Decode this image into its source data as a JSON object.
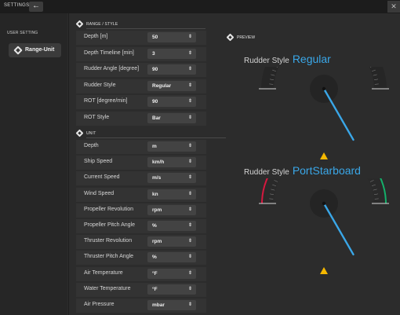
{
  "window": {
    "title": "SETTINGS",
    "back_icon": "arrow-left",
    "close_icon": "close"
  },
  "sidebar": {
    "label": "USER SETTING",
    "items": [
      {
        "label": "Range-Unit",
        "icon": "diamond"
      }
    ]
  },
  "range_style": {
    "title": "RANGE / STYLE",
    "rows": [
      {
        "label": "Depth [m]",
        "value": "50"
      },
      {
        "label": "Depth Timeline [min]",
        "value": "3"
      },
      {
        "label": "Rudder Angle [degree]",
        "value": "90"
      },
      {
        "label": "Rudder Style",
        "value": "Regular"
      },
      {
        "label": "ROT [degree/min]",
        "value": "90"
      },
      {
        "label": "ROT Style",
        "value": "Bar"
      }
    ]
  },
  "unit": {
    "title": "UNIT",
    "rows": [
      {
        "label": "Depth",
        "value": "m"
      },
      {
        "label": "Ship Speed",
        "value": "km/h"
      },
      {
        "label": "Current Speed",
        "value": "m/s"
      },
      {
        "label": "Wind Speed",
        "value": "kn"
      },
      {
        "label": "Propeller Revolution",
        "value": "rpm"
      },
      {
        "label": "Propeller Pitch Angle",
        "value": "%"
      },
      {
        "label": "Thruster Revolution",
        "value": "rpm"
      },
      {
        "label": "Thruster Pitch Angle",
        "value": "%"
      },
      {
        "label": "Air Temperature",
        "value": "°F"
      },
      {
        "label": "Water Temperature",
        "value": "°F"
      },
      {
        "label": "Air Pressure",
        "value": "mbar"
      }
    ]
  },
  "preview": {
    "title": "PREVIEW",
    "gauges": [
      {
        "label": "Rudder Style",
        "style": "Regular",
        "needle_angle": 30,
        "colors": {
          "needle": "#3aa7e8",
          "pointer": "#f5b800",
          "arc": "#262626"
        }
      },
      {
        "label": "Rudder Style",
        "style": "PortStarboard",
        "needle_angle": 30,
        "colors": {
          "needle": "#3aa7e8",
          "pointer": "#f5b800",
          "port": "#d6183f",
          "starboard": "#14b06a"
        }
      }
    ]
  }
}
